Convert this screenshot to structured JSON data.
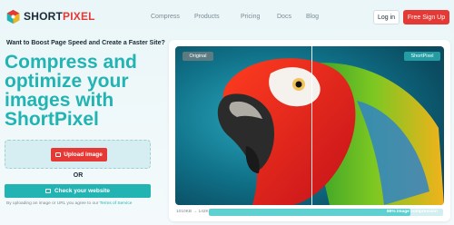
{
  "header": {
    "logo_short": "SHORT",
    "logo_pixel": "PIXEL",
    "menu": [
      "Compress",
      "Products",
      "Pricing",
      "Docs",
      "Blog"
    ],
    "login_label": "Log in",
    "signup_label": "Free Sign Up"
  },
  "hero": {
    "kicker": "Want to Boost Page Speed and Create a Faster Site?",
    "headline": "Compress and optimize your images with ShortPixel",
    "upload_label": "Upload image",
    "or_label": "OR",
    "check_label": "Check your website",
    "terms_prefix": "By uploading an image or URL you agree to our ",
    "terms_link": "Terms of Service"
  },
  "comparison": {
    "original_tag": "Original",
    "shortpixel_tag": "ShortPixel",
    "sizes": "1010KB → 142KB",
    "compression_label": "86% image compression",
    "compression_fraction": 0.86
  },
  "colors": {
    "brand_red": "#e53935",
    "brand_teal": "#22b3b3"
  }
}
